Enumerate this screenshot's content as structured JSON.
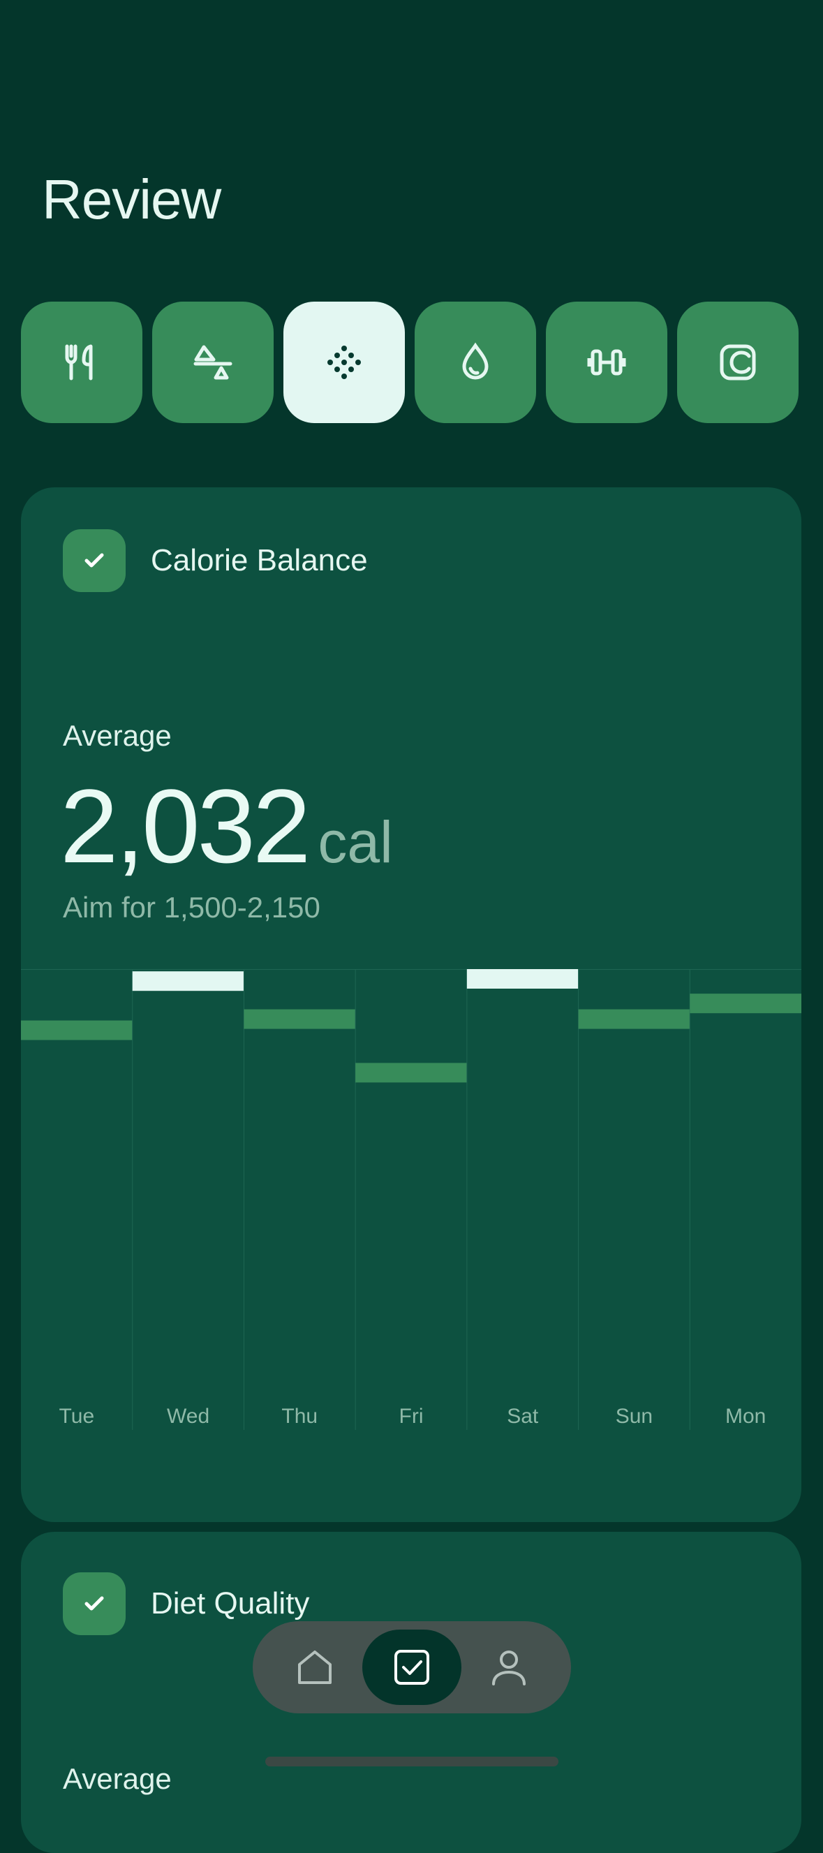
{
  "header": {
    "title": "Review"
  },
  "categories": [
    {
      "icon": "utensils-icon",
      "selected": false
    },
    {
      "icon": "balance-icon",
      "selected": false
    },
    {
      "icon": "dots-grid-icon",
      "selected": true
    },
    {
      "icon": "water-drop-icon",
      "selected": false
    },
    {
      "icon": "dumbbell-icon",
      "selected": false
    },
    {
      "icon": "c-square-icon",
      "selected": false
    }
  ],
  "calorie_card": {
    "title": "Calorie Balance",
    "average_label": "Average",
    "average_value": "2,032",
    "unit": "cal",
    "aim_text": "Aim for 1,500-2,150"
  },
  "chart_data": {
    "type": "bar",
    "categories": [
      "Tue",
      "Wed",
      "Thu",
      "Fri",
      "Sat",
      "Sun",
      "Mon"
    ],
    "values": [
      0.885,
      0.995,
      0.91,
      0.79,
      1.0,
      0.91,
      0.945
    ],
    "highlight": [
      false,
      true,
      false,
      false,
      true,
      false,
      false
    ],
    "colors": {
      "normal": "#378c5a",
      "highlight": "#e3f7f2"
    }
  },
  "diet_card": {
    "title": "Diet Quality",
    "average_label": "Average"
  },
  "bottom_nav": {
    "items": [
      {
        "icon": "home-icon",
        "active": false
      },
      {
        "icon": "checkbox-icon",
        "active": true
      },
      {
        "icon": "profile-icon",
        "active": false
      }
    ]
  }
}
